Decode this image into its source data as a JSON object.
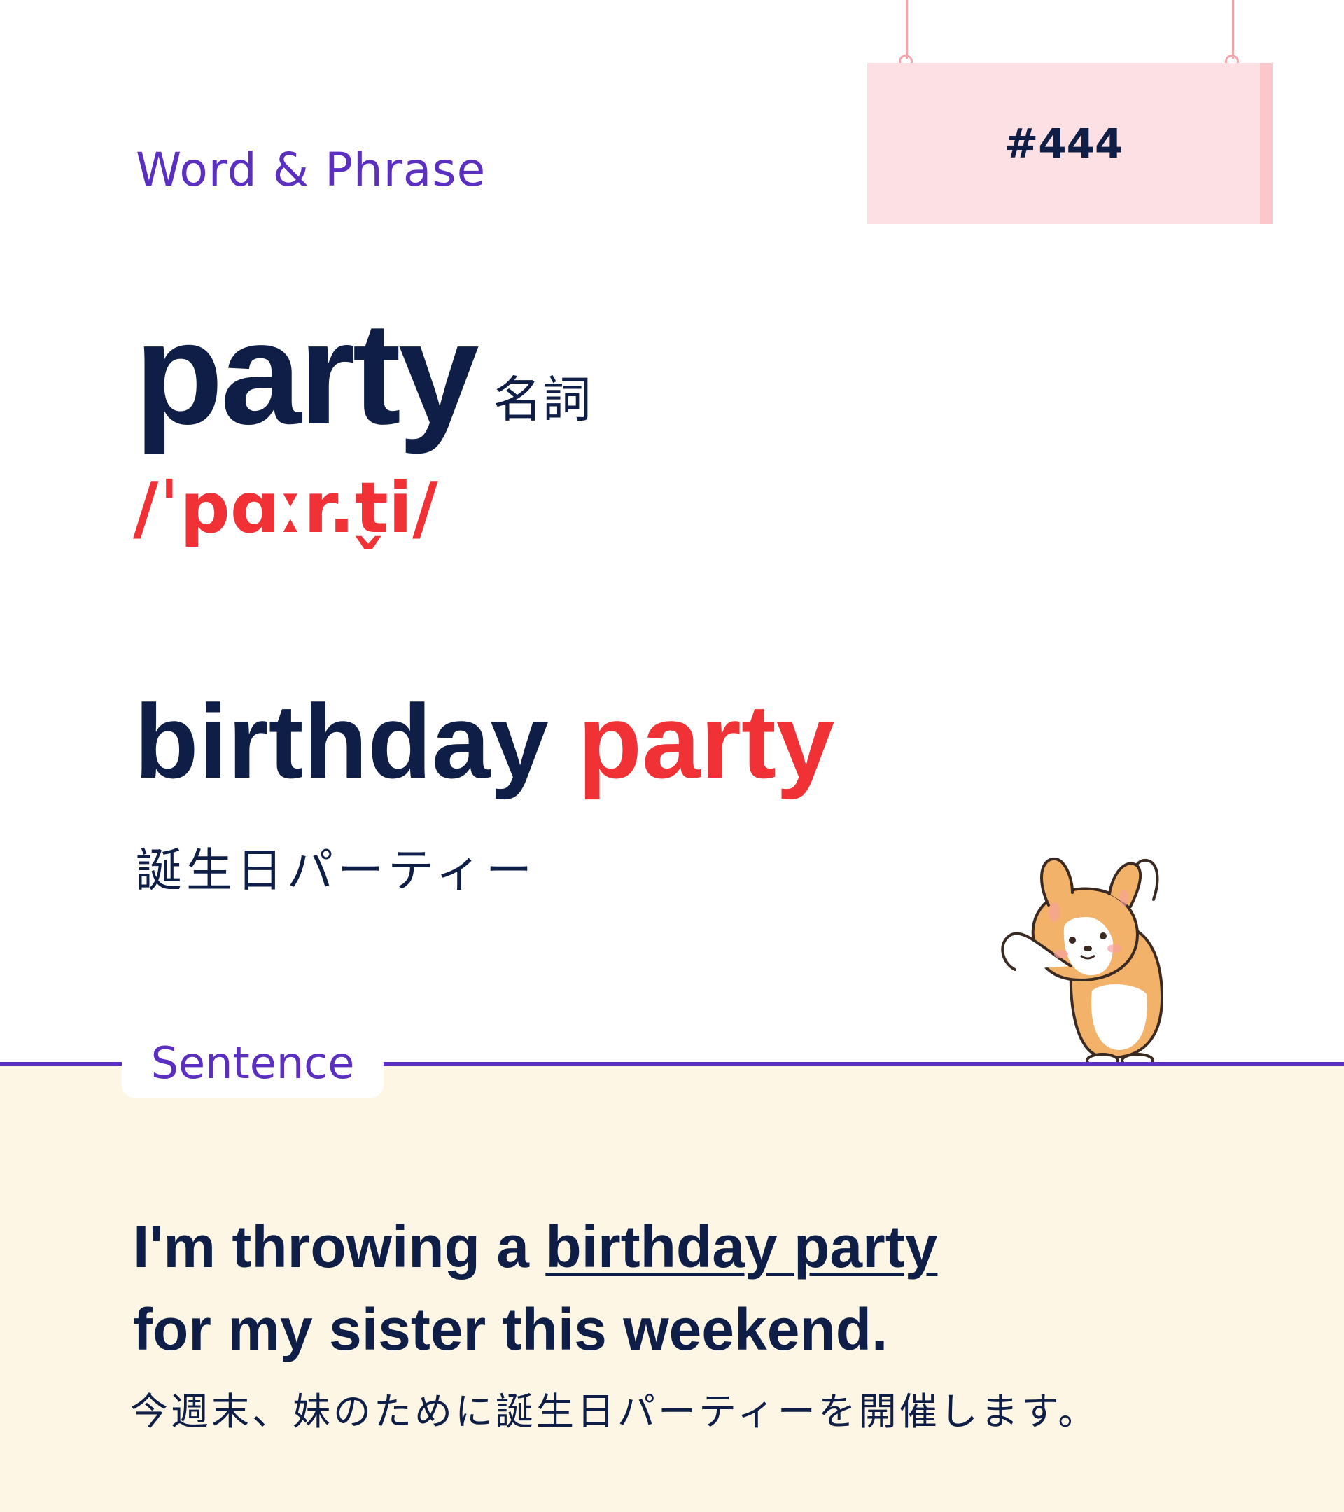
{
  "header": {
    "section_label": "Word & Phrase",
    "entry_number": "#444"
  },
  "word": {
    "headword": "party",
    "part_of_speech": "名詞",
    "pronunciation": "/ˈpɑːr.t̬i/"
  },
  "phrase": {
    "main": "birthday",
    "highlight": "party",
    "translation": "誕生日パーティー"
  },
  "sentence_section": {
    "label": "Sentence",
    "line1_start": "I'm throwing a ",
    "line1_underlined": "birthday party",
    "line2": "for my sister this weekend.",
    "translation": "今週末、妹のために誕生日パーティーを開催します。"
  },
  "colors": {
    "navy": "#0f1e46",
    "accent_red": "#f03236",
    "purple": "#5b30c0",
    "sign_pink": "#fde0e3",
    "panel_cream": "#fdf6e4"
  },
  "illustration": {
    "icon": "corgi-dog-icon"
  }
}
